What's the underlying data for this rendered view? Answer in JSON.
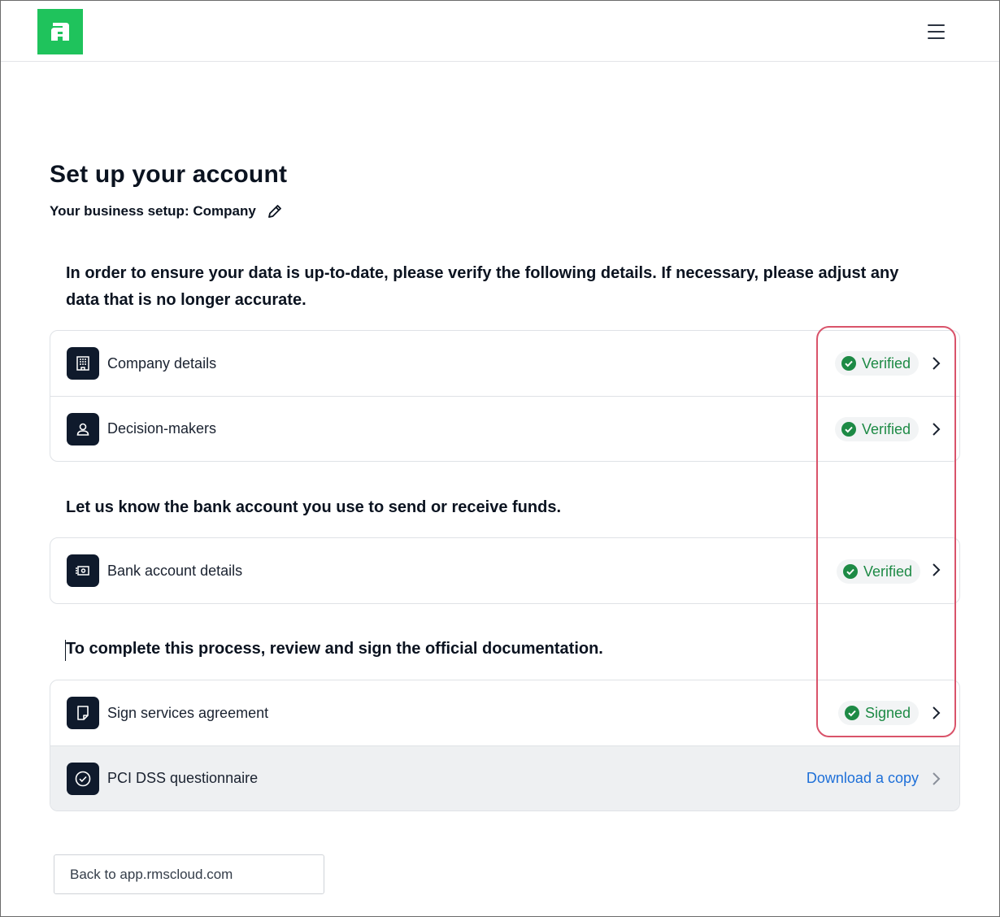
{
  "header": {
    "logo_icon": "brand-logo-icon",
    "menu_icon": "hamburger-menu-icon",
    "brand_color": "#1fc35c"
  },
  "page": {
    "title": "Set up your account",
    "business_setup": "Your business setup: Company",
    "edit_icon": "pencil-edit-icon"
  },
  "sections": {
    "verify_intro": "In order to ensure your data is up-to-date, please verify the following details. If necessary, please adjust any data that is no longer accurate.",
    "bank_intro": "Let us know the bank account you use to send or receive funds.",
    "docs_intro": "To complete this process, review and sign the official documentation."
  },
  "rows": {
    "company": {
      "label": "Company details",
      "status": "Verified",
      "icon": "building-icon"
    },
    "decision": {
      "label": "Decision-makers",
      "status": "Verified",
      "icon": "person-icon"
    },
    "bank": {
      "label": "Bank account details",
      "status": "Verified",
      "icon": "banknote-icon"
    },
    "sign": {
      "label": "Sign services agreement",
      "status": "Signed",
      "icon": "document-sign-icon"
    },
    "pci": {
      "label": "PCI DSS questionnaire",
      "action": "Download a copy",
      "icon": "check-circle-icon"
    }
  },
  "status_color": "#1d8a45",
  "link_color": "#1d6fd8",
  "footer": {
    "back_label": "Back to app.rmscloud.com"
  }
}
